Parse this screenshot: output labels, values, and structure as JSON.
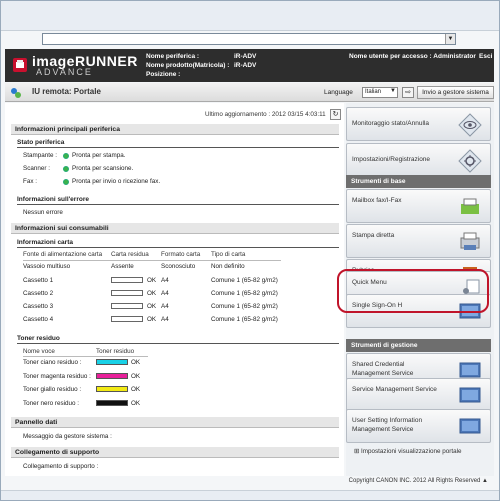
{
  "header": {
    "brand_line1": "imageRUNNER",
    "brand_line2": "ADVANCE",
    "device_name_label": "Nome periferica :",
    "device_name_value": "iR-ADV",
    "product_name_label": "Nome prodotto(Matricola) :",
    "product_name_value": "iR-ADV",
    "position_label": "Posizione :",
    "user_label": "Nome utente per accesso : Administrator",
    "logout_label": "Esci"
  },
  "toolbar": {
    "title": "IU remota: Portale",
    "language_label": "Language",
    "language_value": "Italian",
    "invio_button": "Invio a gestore sistema"
  },
  "main": {
    "last_update": "Ultimo aggiornamento : 2012 03/15 4:03:11",
    "section_device_info": "Informazioni principali periferica",
    "status_title": "Stato periferica",
    "status": [
      {
        "label": "Stampante :",
        "value": "Pronta per stampa."
      },
      {
        "label": "Scanner :",
        "value": "Pronta per scansione."
      },
      {
        "label": "Fax :",
        "value": "Pronta per invio o ricezione fax."
      }
    ],
    "error_title": "Informazioni sull'errore",
    "error_value": "Nessun errore",
    "section_consumables": "Informazioni sui consumabili",
    "paper_title": "Informazioni carta",
    "paper_headers": [
      "Fonte di alimentazione carta",
      "Carta residua",
      "Formato carta",
      "Tipo di carta"
    ],
    "paper_rows": [
      {
        "source": "Vassoio multiuso",
        "remaining": "Assente",
        "size": "Sconosciuto",
        "type": "Non definito"
      },
      {
        "source": "Cassetto 1",
        "remaining": "OK",
        "size": "A4",
        "type": "Comune 1 (65-82 g/m2)"
      },
      {
        "source": "Cassetto 2",
        "remaining": "OK",
        "size": "A4",
        "type": "Comune 1 (65-82 g/m2)"
      },
      {
        "source": "Cassetto 3",
        "remaining": "OK",
        "size": "A4",
        "type": "Comune 1 (65-82 g/m2)"
      },
      {
        "source": "Cassetto 4",
        "remaining": "OK",
        "size": "A4",
        "type": "Comune 1 (65-82 g/m2)"
      }
    ],
    "toner_title": "Toner residuo",
    "toner_headers": [
      "Nome voce",
      "Toner residuo"
    ],
    "toner_rows": [
      {
        "name": "Toner ciano residuo :",
        "status": "OK",
        "color": "#19d1e6"
      },
      {
        "name": "Toner magenta residuo :",
        "status": "OK",
        "color": "#e8209a"
      },
      {
        "name": "Toner giallo residuo :",
        "status": "OK",
        "color": "#f2ea14"
      },
      {
        "name": "Toner nero residuo :",
        "status": "OK",
        "color": "#111111"
      }
    ],
    "data_panel_title": "Pannello dati",
    "data_panel_value": "Messaggio da gestore sistema :",
    "support_title": "Collegamento di supporto",
    "support_value": "Collegamento di supporto :"
  },
  "sidebar": {
    "top_buttons": [
      "Monitoraggio stato/Annulla",
      "Impostazioni/Registrazione"
    ],
    "basic_header": "Strumenti di base",
    "basic_buttons": [
      "Mailbox fax/I-Fax",
      "Stampa diretta",
      "Rubrica",
      "Quick Menu",
      "Single Sign-On H"
    ],
    "manage_header": "Strumenti di gestione",
    "manage_buttons": [
      "Shared Credential Management Service",
      "Service Management Service",
      "User Setting Information Management Service"
    ],
    "portal_settings": "Impostazioni visualizzazione portale"
  },
  "footer": {
    "copyright": "Copyright CANON INC. 2012 All Rights Reserved"
  }
}
